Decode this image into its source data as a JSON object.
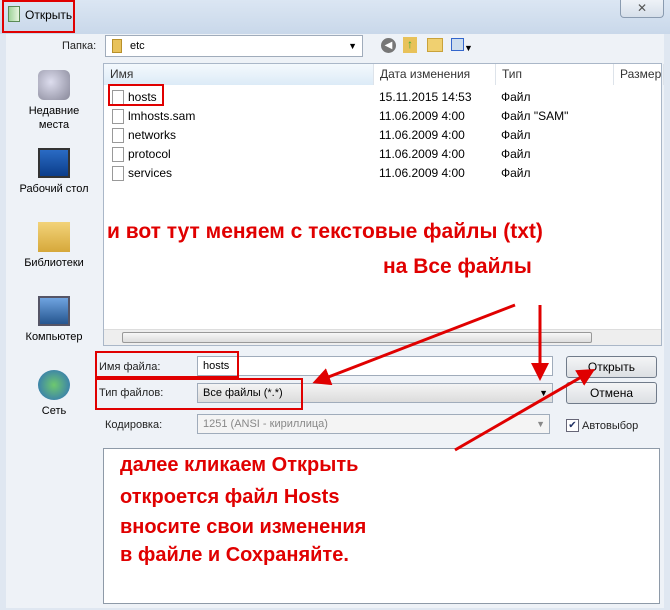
{
  "window": {
    "title": "Открыть",
    "close_icon": "✕"
  },
  "toolbar": {
    "folder_label": "Папка:",
    "folder_value": "etc"
  },
  "places": [
    {
      "label": "Недавние места"
    },
    {
      "label": "Рабочий стол"
    },
    {
      "label": "Библиотеки"
    },
    {
      "label": "Компьютер"
    },
    {
      "label": "Сеть"
    }
  ],
  "columns": {
    "name": "Имя",
    "date": "Дата изменения",
    "type": "Тип",
    "size": "Размер"
  },
  "files": [
    {
      "name": "hosts",
      "date": "15.11.2015 14:53",
      "type": "Файл"
    },
    {
      "name": "lmhosts.sam",
      "date": "11.06.2009 4:00",
      "type": "Файл \"SAM\""
    },
    {
      "name": "networks",
      "date": "11.06.2009 4:00",
      "type": "Файл"
    },
    {
      "name": "protocol",
      "date": "11.06.2009 4:00",
      "type": "Файл"
    },
    {
      "name": "services",
      "date": "11.06.2009 4:00",
      "type": "Файл"
    }
  ],
  "form": {
    "filename_label": "Имя файла:",
    "filename_value": "hosts",
    "filetype_label": "Тип файлов:",
    "filetype_value": "Все файлы (*.*)",
    "encoding_label": "Кодировка:",
    "encoding_value": "1251  (ANSI - кириллица)",
    "open_button": "Открыть",
    "cancel_button": "Отмена",
    "autoselect_label": "Автовыбор"
  },
  "annotations": {
    "line1": "и вот тут меняем с текстовые файлы (txt)",
    "line2": "на Все файлы",
    "line3": "далее кликаем Открыть",
    "line4": "откроется файл Hosts",
    "line5": "вносите свои изменения",
    "line6": "в файле и Сохраняйте."
  },
  "colors": {
    "annotation": "#e00000"
  }
}
